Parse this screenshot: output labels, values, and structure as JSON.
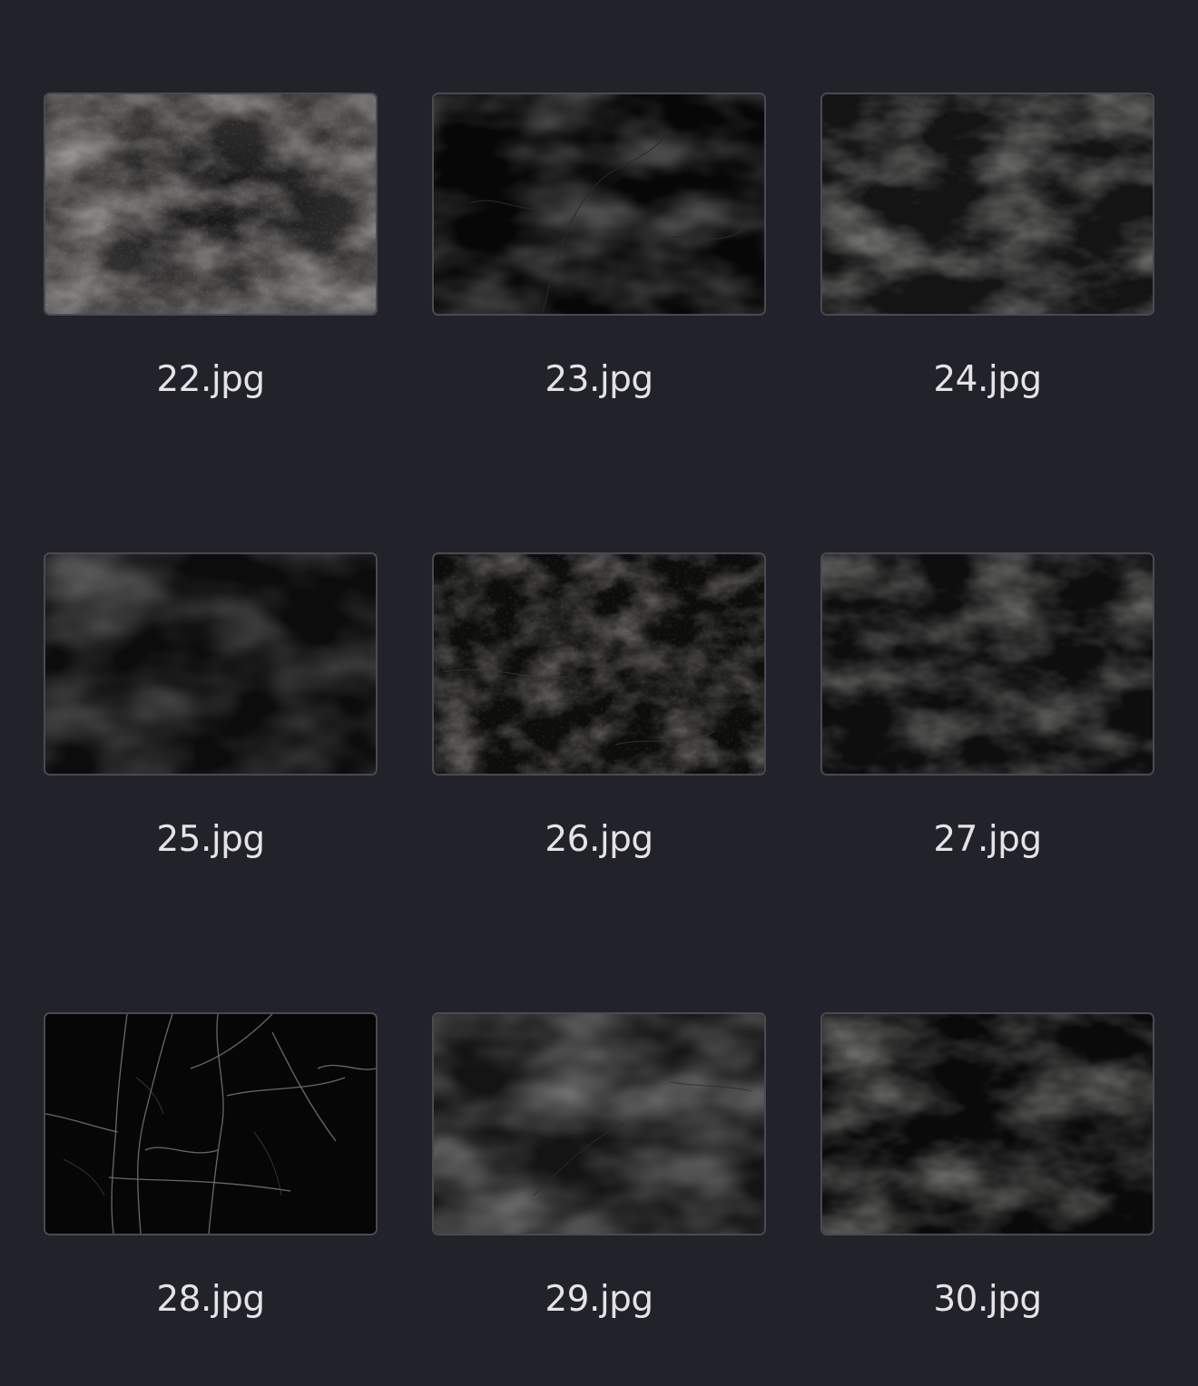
{
  "files": [
    {
      "name": "22.jpg",
      "thumbnail": "dark-grunge-texture-light-grey-clouds"
    },
    {
      "name": "23.jpg",
      "thumbnail": "black-marble-faint-veins"
    },
    {
      "name": "24.jpg",
      "thumbnail": "dark-grunge-texture"
    },
    {
      "name": "25.jpg",
      "thumbnail": "near-black-smooth-texture"
    },
    {
      "name": "26.jpg",
      "thumbnail": "black-cracked-stone-texture"
    },
    {
      "name": "27.jpg",
      "thumbnail": "dark-stained-texture"
    },
    {
      "name": "28.jpg",
      "thumbnail": "black-marble-white-cracks"
    },
    {
      "name": "29.jpg",
      "thumbnail": "dark-grey-smoky-texture"
    },
    {
      "name": "30.jpg",
      "thumbnail": "black-grunge-texture"
    }
  ]
}
